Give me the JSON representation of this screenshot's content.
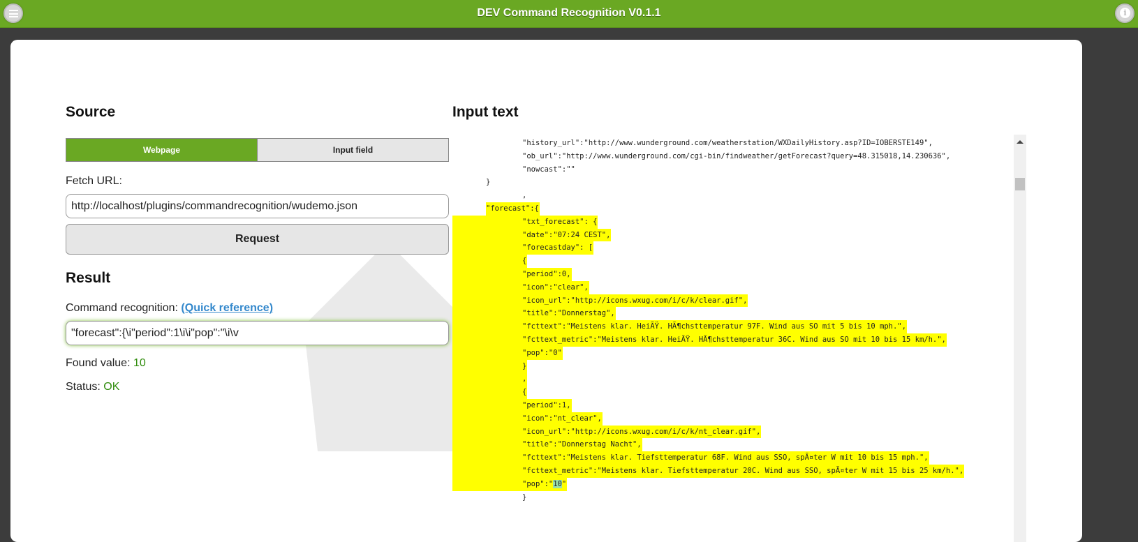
{
  "header": {
    "title": "DEV Command Recognition V0.1.1"
  },
  "source": {
    "heading": "Source",
    "tabs": [
      "Webpage",
      "Input field"
    ],
    "fetch_label": "Fetch URL:",
    "url": "http://localhost/plugins/commandrecognition/wudemo.json",
    "request_label": "Request"
  },
  "result": {
    "heading": "Result",
    "cmd_label": "Command recognition:",
    "quick_ref": "(Quick reference)",
    "command": "\"forecast\":{\\i\"period\":1\\i\\i\"pop\":\"\\i\\v",
    "found_label": "Found value:",
    "found_value": "10",
    "status_label": "Status:",
    "status_value": "OK"
  },
  "input_text": {
    "heading": "Input text",
    "lines": [
      {
        "i": 2,
        "h": "",
        "t": "\"history_url\":\"http://www.wunderground.com/weatherstation/WXDailyHistory.asp?ID=IOBERSTE149\","
      },
      {
        "i": 2,
        "h": "",
        "t": "\"ob_url\":\"http://www.wunderground.com/cgi-bin/findweather/getForecast?query=48.315018,14.230636\","
      },
      {
        "i": 2,
        "h": "",
        "t": "\"nowcast\":\"\""
      },
      {
        "i": 1,
        "h": "",
        "t": "}"
      },
      {
        "i": 2,
        "h": "",
        "t": ","
      },
      {
        "i": 1,
        "h": "text",
        "t": "\"forecast\":{"
      },
      {
        "i": 2,
        "h": "full",
        "t": "\"txt_forecast\": {"
      },
      {
        "i": 2,
        "h": "full",
        "t": "\"date\":\"07:24 CEST\","
      },
      {
        "i": 2,
        "h": "full",
        "t": "\"forecastday\": ["
      },
      {
        "i": 2,
        "h": "full",
        "t": "{"
      },
      {
        "i": 2,
        "h": "full",
        "t": "\"period\":0,"
      },
      {
        "i": 2,
        "h": "full",
        "t": "\"icon\":\"clear\","
      },
      {
        "i": 2,
        "h": "full",
        "t": "\"icon_url\":\"http://icons.wxug.com/i/c/k/clear.gif\","
      },
      {
        "i": 2,
        "h": "full",
        "t": "\"title\":\"Donnerstag\","
      },
      {
        "i": 2,
        "h": "full",
        "t": "\"fcttext\":\"Meistens klar. HeiÃŸ. HÃ¶chsttemperatur 97F. Wind aus SO mit 5 bis 10 mph.\","
      },
      {
        "i": 2,
        "h": "full",
        "t": "\"fcttext_metric\":\"Meistens klar. HeiÃŸ. HÃ¶chsttemperatur 36C. Wind aus SO mit 10 bis 15 km/h.\","
      },
      {
        "i": 2,
        "h": "full",
        "t": "\"pop\":\"0\""
      },
      {
        "i": 2,
        "h": "full",
        "t": "}"
      },
      {
        "i": 2,
        "h": "full",
        "t": ","
      },
      {
        "i": 2,
        "h": "full",
        "t": "{"
      },
      {
        "i": 2,
        "h": "full",
        "t": "\"period\":1,"
      },
      {
        "i": 2,
        "h": "full",
        "t": "\"icon\":\"nt_clear\","
      },
      {
        "i": 2,
        "h": "full",
        "t": "\"icon_url\":\"http://icons.wxug.com/i/c/k/nt_clear.gif\","
      },
      {
        "i": 2,
        "h": "full",
        "t": "\"title\":\"Donnerstag Nacht\","
      },
      {
        "i": 2,
        "h": "full",
        "t": "\"fcttext\":\"Meistens klar. Tiefsttemperatur 68F. Wind aus SSO, spÃ¤ter W mit 10 bis 15 mph.\","
      },
      {
        "i": 2,
        "h": "full",
        "t": "\"fcttext_metric\":\"Meistens klar. Tiefsttemperatur 20C. Wind aus SSO, spÃ¤ter W mit 15 bis 25 km/h.\","
      },
      {
        "i": 2,
        "h": "full",
        "t": "\"pop\":\"",
        "m": "10",
        "a": "\""
      },
      {
        "i": 2,
        "h": "",
        "t": "}"
      }
    ]
  },
  "colors": {
    "brand": "#6aa823",
    "highlight": "#ffff00",
    "match": "#98e0a8"
  }
}
